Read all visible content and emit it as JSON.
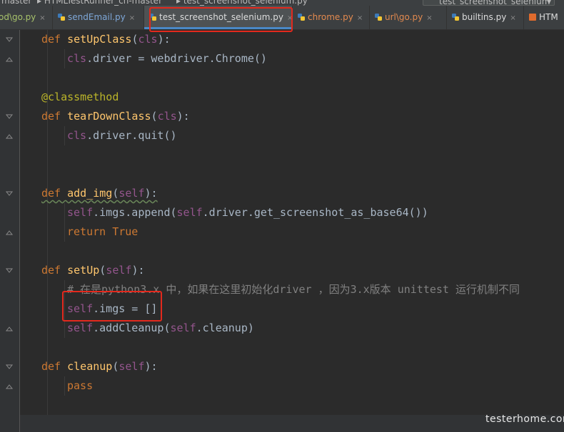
{
  "breadcrumb": {
    "items": [
      "master",
      "HTMLTestRunner_cn-master",
      "test_screenshot_selenium.py"
    ],
    "run_config": "test_screenshot_selenium"
  },
  "tabs": [
    {
      "label": "od\\go.py",
      "color": "green",
      "active": false
    },
    {
      "label": "sendEmail.py",
      "color": "blue",
      "active": false
    },
    {
      "label": "test_screenshot_selenium.py",
      "color": "white",
      "active": true
    },
    {
      "label": "chrome.py",
      "color": "orange",
      "active": false
    },
    {
      "label": "url\\go.py",
      "color": "orange",
      "active": false
    },
    {
      "label": "builtins.py",
      "color": "white",
      "active": false
    },
    {
      "label": "HTM",
      "color": "white",
      "active": false
    }
  ],
  "tab_close_glyph": "×",
  "code": {
    "l1": {
      "kw": "def ",
      "fn": "setUpClass",
      "p1": "(",
      "slf": "cls",
      "p2": "):"
    },
    "l2": {
      "slf": "cls",
      "rest": ".driver = webdriver.Chrome()"
    },
    "l4": {
      "dec": "@classmethod"
    },
    "l5": {
      "kw": "def ",
      "fn": "tearDownClass",
      "p1": "(",
      "slf": "cls",
      "p2": "):"
    },
    "l6": {
      "slf": "cls",
      "rest": ".driver.quit()"
    },
    "l9": {
      "kw": "def ",
      "fn": "add_img",
      "p1": "(",
      "slf": "self",
      "p2": "):"
    },
    "l10": {
      "slf1": "self",
      "mid": ".imgs.append(",
      "slf2": "self",
      "rest": ".driver.get_screenshot_as_base64())"
    },
    "l11": {
      "kw": "return ",
      "kw2": "True"
    },
    "l13": {
      "kw": "def ",
      "fn": "setUp",
      "p1": "(",
      "slf": "self",
      "p2": "):"
    },
    "l14": {
      "cmt": "# 在是python3.x 中，如果在这里初始化driver ，因为3.x版本 unittest 运行机制不同"
    },
    "l15": {
      "slf": "self",
      "rest": ".imgs = []"
    },
    "l16": {
      "slf1": "self",
      "mid": ".addCleanup(",
      "slf2": "self",
      "rest": ".cleanup)"
    },
    "l18": {
      "kw": "def ",
      "fn": "cleanup",
      "p1": "(",
      "slf": "self",
      "p2": "):"
    },
    "l19": {
      "kw": "pass"
    }
  },
  "watermark": "testerhome.com",
  "colors": {
    "highlight": "#e3291d",
    "keyword": "#cc7832",
    "function": "#ffc66d",
    "self": "#94558d"
  }
}
